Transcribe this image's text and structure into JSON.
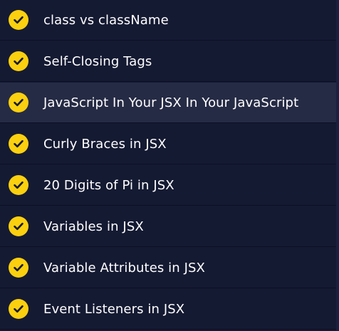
{
  "lessons": [
    {
      "label": "class vs className",
      "completed": true,
      "active": false
    },
    {
      "label": "Self-Closing Tags",
      "completed": true,
      "active": false
    },
    {
      "label": "JavaScript In Your JSX In Your JavaScript",
      "completed": true,
      "active": true
    },
    {
      "label": "Curly Braces in JSX",
      "completed": true,
      "active": false
    },
    {
      "label": "20 Digits of Pi in JSX",
      "completed": true,
      "active": false
    },
    {
      "label": "Variables in JSX",
      "completed": true,
      "active": false
    },
    {
      "label": "Variable Attributes in JSX",
      "completed": true,
      "active": false
    },
    {
      "label": "Event Listeners in JSX",
      "completed": true,
      "active": false
    }
  ],
  "colors": {
    "background": "#151a33",
    "active_row": "#262b45",
    "check_fill": "#fbd00f",
    "check_mark": "#151a33",
    "text": "#ffffff"
  },
  "icons": {
    "completed": "checkmark-circle-icon"
  }
}
